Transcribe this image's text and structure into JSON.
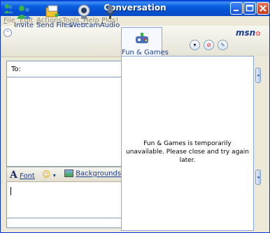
{
  "window": {
    "title": "Conversation"
  },
  "menu": [
    {
      "label": "File",
      "mnemonic": "F",
      "rest": "ile"
    },
    {
      "label": "Edit",
      "mnemonic": "E",
      "rest": "dit"
    },
    {
      "label": "Actions",
      "mnemonic": "A",
      "rest": "ctions"
    },
    {
      "label": "Tools",
      "mnemonic": "T",
      "rest": "ools"
    },
    {
      "label": "Help",
      "mnemonic": "H",
      "rest": "elp"
    },
    {
      "label": "Plus!",
      "mnemonic": "P",
      "rest": "lus!"
    }
  ],
  "toolbar": {
    "invite": "Invite",
    "send_files": "Send Files",
    "webcam": "Webcam",
    "audio": "Audio",
    "fun_games": "Fun & Games",
    "logo": "msn"
  },
  "conversation": {
    "to_label": "To:"
  },
  "format_bar": {
    "font": "Font",
    "backgrounds": "Backgrounds"
  },
  "games_panel": {
    "message": "Fun & Games is temporarily unavailable. Please close and try again later."
  },
  "colors": {
    "titlebar": "#0a5fe0",
    "accent": "#1c3f94",
    "close": "#c63a17"
  }
}
